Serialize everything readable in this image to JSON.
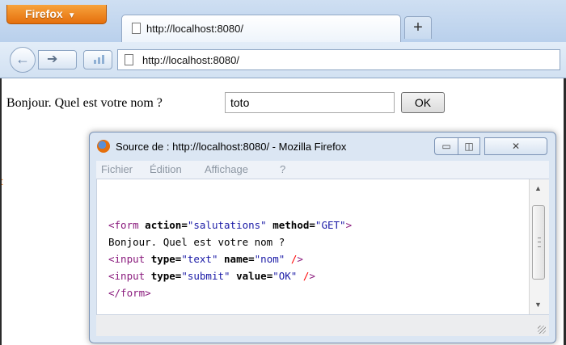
{
  "browser": {
    "app_button": "Firefox",
    "tab_title": "http://localhost:8080/",
    "new_tab": "+",
    "url": "http://localhost:8080/"
  },
  "page": {
    "prompt": "Bonjour. Quel est votre nom ?",
    "name_value": "toto",
    "ok_label": "OK",
    "stray_char": "t"
  },
  "source_window": {
    "title": "Source de : http://localhost:8080/ - Mozilla Firefox",
    "menu": {
      "file": "Fichier",
      "edit": "Édition",
      "view": "Affichage",
      "help": "?"
    },
    "code_lines": [
      "<form action=\"salutations\" method=\"GET\">",
      "Bonjour. Quel est votre nom ?",
      "<input type=\"text\" name=\"nom\" />",
      "<input type=\"submit\" value=\"OK\" />",
      "</form>"
    ]
  },
  "icons": [
    "firefox-menu-arrow-icon",
    "page-icon",
    "back-icon",
    "forward-icon",
    "bars-icon",
    "firefox-logo-icon",
    "minimize-icon",
    "maximize-icon",
    "close-icon"
  ],
  "colors": {
    "firefox_orange": "#e56f0c",
    "chrome_blue": "#cfdff2",
    "tag_purple": "#8a1b7d",
    "value_blue": "#1a1aa6",
    "slash_red": "#ff0000"
  }
}
